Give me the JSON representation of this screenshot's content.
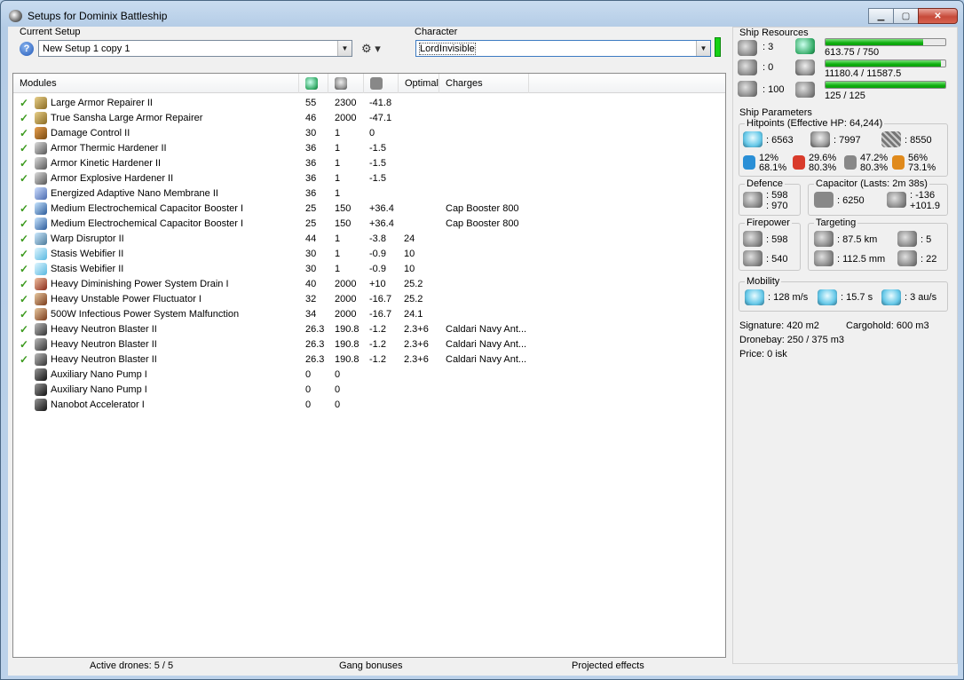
{
  "window": {
    "title": "Setups for Dominix Battleship",
    "buttons": {
      "minimize": "▁",
      "maximize": "▢",
      "close": "✕"
    }
  },
  "setup": {
    "label": "Current Setup",
    "value": "New Setup 1 copy 1",
    "help_glyph": "?",
    "tool_glyph": "⚙ ▾"
  },
  "character": {
    "label": "Character",
    "value": "LordInvisible"
  },
  "modules": {
    "headers": [
      "Modules",
      "",
      "",
      "",
      "Optimal",
      "Charges"
    ],
    "header_icons": [
      "cpu-icon",
      "powergrid-icon",
      "capacitor-icon"
    ],
    "rows": [
      {
        "check": "✓",
        "icon": "armor-repairer-icon",
        "name": "Large Armor Repairer II",
        "cpu": "55",
        "pg": "2300",
        "cap": "-41.8",
        "optimal": "",
        "charges": ""
      },
      {
        "check": "✓",
        "icon": "armor-repairer-icon",
        "name": "True Sansha Large Armor Repairer",
        "cpu": "46",
        "pg": "2000",
        "cap": "-47.1",
        "optimal": "",
        "charges": ""
      },
      {
        "check": "✓",
        "icon": "damage-control-icon",
        "name": "Damage Control II",
        "cpu": "30",
        "pg": "1",
        "cap": "0",
        "optimal": "",
        "charges": ""
      },
      {
        "check": "✓",
        "icon": "hardener-icon",
        "name": "Armor Thermic Hardener II",
        "cpu": "36",
        "pg": "1",
        "cap": "-1.5",
        "optimal": "",
        "charges": ""
      },
      {
        "check": "✓",
        "icon": "hardener-icon",
        "name": "Armor Kinetic Hardener II",
        "cpu": "36",
        "pg": "1",
        "cap": "-1.5",
        "optimal": "",
        "charges": ""
      },
      {
        "check": "✓",
        "icon": "hardener-icon",
        "name": "Armor Explosive Hardener II",
        "cpu": "36",
        "pg": "1",
        "cap": "-1.5",
        "optimal": "",
        "charges": ""
      },
      {
        "check": "",
        "icon": "membrane-icon",
        "name": "Energized Adaptive Nano Membrane II",
        "cpu": "36",
        "pg": "1",
        "cap": "",
        "optimal": "",
        "charges": ""
      },
      {
        "check": "✓",
        "icon": "cap-booster-icon",
        "name": "Medium Electrochemical Capacitor Booster I",
        "cpu": "25",
        "pg": "150",
        "cap": "+36.4",
        "optimal": "",
        "charges": "Cap Booster 800"
      },
      {
        "check": "✓",
        "icon": "cap-booster-icon",
        "name": "Medium Electrochemical Capacitor Booster I",
        "cpu": "25",
        "pg": "150",
        "cap": "+36.4",
        "optimal": "",
        "charges": "Cap Booster 800"
      },
      {
        "check": "✓",
        "icon": "warp-disruptor-icon",
        "name": "Warp Disruptor II",
        "cpu": "44",
        "pg": "1",
        "cap": "-3.8",
        "optimal": "24",
        "charges": ""
      },
      {
        "check": "✓",
        "icon": "stasis-webifier-icon",
        "name": "Stasis Webifier II",
        "cpu": "30",
        "pg": "1",
        "cap": "-0.9",
        "optimal": "10",
        "charges": ""
      },
      {
        "check": "✓",
        "icon": "stasis-webifier-icon",
        "name": "Stasis Webifier II",
        "cpu": "30",
        "pg": "1",
        "cap": "-0.9",
        "optimal": "10",
        "charges": ""
      },
      {
        "check": "✓",
        "icon": "energy-drain-icon",
        "name": "Heavy Diminishing Power System Drain I",
        "cpu": "40",
        "pg": "2000",
        "cap": "+10",
        "optimal": "25.2",
        "charges": ""
      },
      {
        "check": "✓",
        "icon": "energy-neutralizer-icon",
        "name": "Heavy Unstable Power Fluctuator I",
        "cpu": "32",
        "pg": "2000",
        "cap": "-16.7",
        "optimal": "25.2",
        "charges": ""
      },
      {
        "check": "✓",
        "icon": "energy-neutralizer-icon",
        "name": "500W Infectious Power System Malfunction",
        "cpu": "34",
        "pg": "2000",
        "cap": "-16.7",
        "optimal": "24.1",
        "charges": ""
      },
      {
        "check": "✓",
        "icon": "blaster-icon",
        "name": "Heavy Neutron Blaster II",
        "cpu": "26.3",
        "pg": "190.8",
        "cap": "-1.2",
        "optimal": "2.3+6",
        "charges": "Caldari Navy Ant..."
      },
      {
        "check": "✓",
        "icon": "blaster-icon",
        "name": "Heavy Neutron Blaster II",
        "cpu": "26.3",
        "pg": "190.8",
        "cap": "-1.2",
        "optimal": "2.3+6",
        "charges": "Caldari Navy Ant..."
      },
      {
        "check": "✓",
        "icon": "blaster-icon",
        "name": "Heavy Neutron Blaster II",
        "cpu": "26.3",
        "pg": "190.8",
        "cap": "-1.2",
        "optimal": "2.3+6",
        "charges": "Caldari Navy Ant..."
      },
      {
        "check": "",
        "icon": "rig-icon",
        "name": "Auxiliary Nano Pump I",
        "cpu": "0",
        "pg": "0",
        "cap": "",
        "optimal": "",
        "charges": ""
      },
      {
        "check": "",
        "icon": "rig-icon",
        "name": "Auxiliary Nano Pump I",
        "cpu": "0",
        "pg": "0",
        "cap": "",
        "optimal": "",
        "charges": ""
      },
      {
        "check": "",
        "icon": "rig-icon",
        "name": "Nanobot Accelerator I",
        "cpu": "0",
        "pg": "0",
        "cap": "",
        "optimal": "",
        "charges": ""
      }
    ]
  },
  "statusbar": {
    "drones": "Active drones: 5 / 5",
    "gang": "Gang bonuses",
    "projected": "Projected effects"
  },
  "resources": {
    "label": "Ship Resources",
    "turret_slots": ": 3",
    "launcher_slots": ": 0",
    "calibration": ": 100",
    "cpu": {
      "text": "613.75 / 750",
      "fill": 0.818
    },
    "powergrid": {
      "text": "11180.4 / 11587.5",
      "fill": 0.965
    },
    "drone_bandwidth": {
      "text": "125 / 125",
      "fill": 1.0
    }
  },
  "parameters": {
    "label": "Ship Parameters",
    "hitpoints": {
      "label": "Hitpoints (Effective HP: 64,244)",
      "shield": ": 6563",
      "armor": ": 7997",
      "hull": ": 8550",
      "em": [
        "12%",
        "68.1%"
      ],
      "thermal": [
        "29.6%",
        "80.3%"
      ],
      "kinetic": [
        "47.2%",
        "80.3%"
      ],
      "explosive": [
        "56%",
        "73.1%"
      ]
    },
    "defence": {
      "label": "Defence",
      "values": [
        ": 598",
        ": 970"
      ]
    },
    "capacitor": {
      "label": "Capacitor (Lasts: 2m 38s)",
      "amount": ": 6250",
      "delta": [
        ": -136",
        "+101.9"
      ]
    },
    "firepower": {
      "label": "Firepower",
      "turret_dps": ": 598",
      "volley": ": 540"
    },
    "targeting": {
      "label": "Targeting",
      "range": ": 87.5 km",
      "max_targets": ": 5",
      "scan_res": ": 112.5 mm",
      "sensor": ": 22"
    },
    "mobility": {
      "label": "Mobility",
      "speed": ": 128 m/s",
      "align": ": 15.7 s",
      "warp": ": 3 au/s"
    },
    "signature": "Signature: 420 m2",
    "cargohold": "Cargohold: 600 m3",
    "dronebay": "Dronebay: 250 / 375 m3",
    "price": "Price: 0 isk"
  }
}
